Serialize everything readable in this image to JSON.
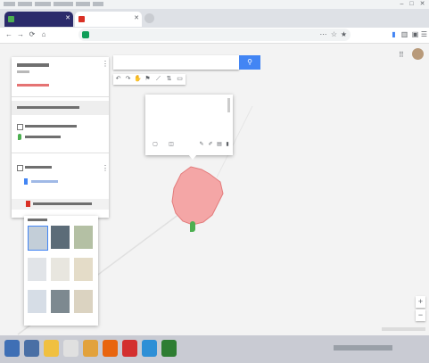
{
  "browser": {
    "tabs": [
      {
        "title": "",
        "active": false
      },
      {
        "title": "",
        "active": true
      }
    ],
    "url": ""
  },
  "map": {
    "search_button_icon": "search-icon",
    "toolbar_icons": [
      "undo-icon",
      "redo-icon",
      "hand-icon",
      "marker-icon",
      "line-icon",
      "route-icon",
      "ruler-icon"
    ],
    "popup": {
      "title": "",
      "description": ""
    },
    "marker_color": "#4caf50",
    "boundary_fill": "#f4a6a6",
    "footer_logo": ""
  },
  "taskbar": {
    "clock": ""
  },
  "colors": {
    "accent": "#4285f4",
    "active_tab": "#2b2b6b",
    "map_background": "#f3f3f3",
    "taskbar": "#c9cbd3"
  }
}
